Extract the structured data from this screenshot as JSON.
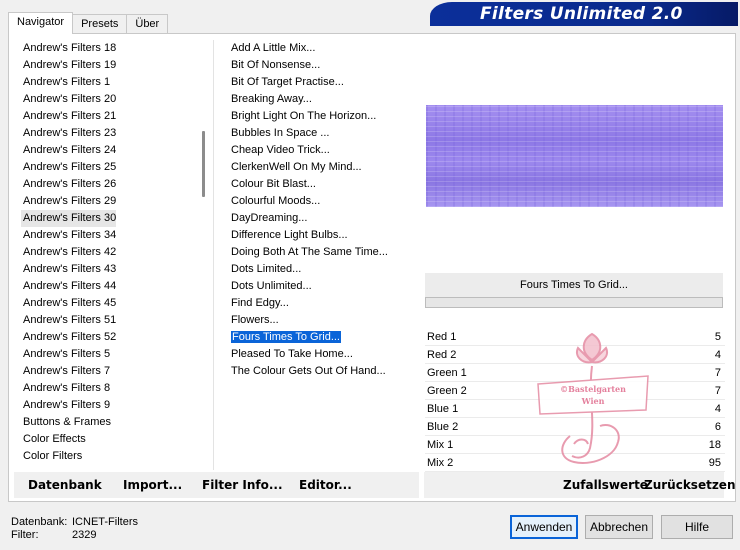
{
  "app": {
    "title": "Filters Unlimited 2.0"
  },
  "tabs": [
    {
      "label": "Navigator"
    },
    {
      "label": "Presets"
    },
    {
      "label": "Über"
    }
  ],
  "categories": [
    "Andrew's Filters 18",
    "Andrew's Filters 19",
    "Andrew's Filters 1",
    "Andrew's Filters 20",
    "Andrew's Filters 21",
    "Andrew's Filters 23",
    "Andrew's Filters 24",
    "Andrew's Filters 25",
    "Andrew's Filters 26",
    "Andrew's Filters 29",
    "Andrew's Filters 30",
    "Andrew's Filters 34",
    "Andrew's Filters 42",
    "Andrew's Filters 43",
    "Andrew's Filters 44",
    "Andrew's Filters 45",
    "Andrew's Filters 51",
    "Andrew's Filters 52",
    "Andrew's Filters 5",
    "Andrew's Filters 7",
    "Andrew's Filters 8",
    "Andrew's Filters 9",
    "Buttons & Frames",
    "Color Effects",
    "Color Filters"
  ],
  "selected_category": "Andrew's Filters 30",
  "filters": [
    "Add A Little Mix...",
    "Bit Of Nonsense...",
    "Bit Of Target Practise...",
    "Breaking Away...",
    "Bright Light On The Horizon...",
    "Bubbles In Space ...",
    "Cheap Video Trick...",
    "ClerkenWell On My Mind...",
    "Colour Bit Blast...",
    "Colourful Moods...",
    "DayDreaming...",
    "Difference Light Bulbs...",
    "Doing Both At The Same Time...",
    "Dots Limited...",
    "Dots Unlimited...",
    "Find Edgy...",
    "Flowers...",
    "Fours Times To Grid...",
    "Pleased To Take Home...",
    "The Colour Gets Out Of Hand..."
  ],
  "selected_filter": "Fours Times To Grid...",
  "left_buttons": {
    "database": "Datenbank",
    "import": "Import...",
    "filter_info": "Filter Info...",
    "editor": "Editor..."
  },
  "preview": {
    "filter_name": "Fours Times To Grid...",
    "accent_color": "#9a86ec"
  },
  "params": [
    {
      "label": "Red 1",
      "value": "5"
    },
    {
      "label": "Red 2",
      "value": "4"
    },
    {
      "label": "Green 1",
      "value": "7"
    },
    {
      "label": "Green 2",
      "value": "7"
    },
    {
      "label": "Blue 1",
      "value": "4"
    },
    {
      "label": "Blue 2",
      "value": "6"
    },
    {
      "label": "Mix 1",
      "value": "18"
    },
    {
      "label": "Mix 2",
      "value": "95"
    }
  ],
  "watermark": {
    "line1": "©Bastelgarten",
    "line2": "Wien"
  },
  "right_buttons": {
    "random": "Zufallswerte",
    "reset": "Zurücksetzen"
  },
  "footer": {
    "database_label": "Datenbank:",
    "database_value": "ICNET-Filters",
    "filter_label": "Filter:",
    "filter_value": "2329"
  },
  "dialog_buttons": {
    "apply": "Anwenden",
    "cancel": "Abbrechen",
    "help": "Hilfe"
  }
}
